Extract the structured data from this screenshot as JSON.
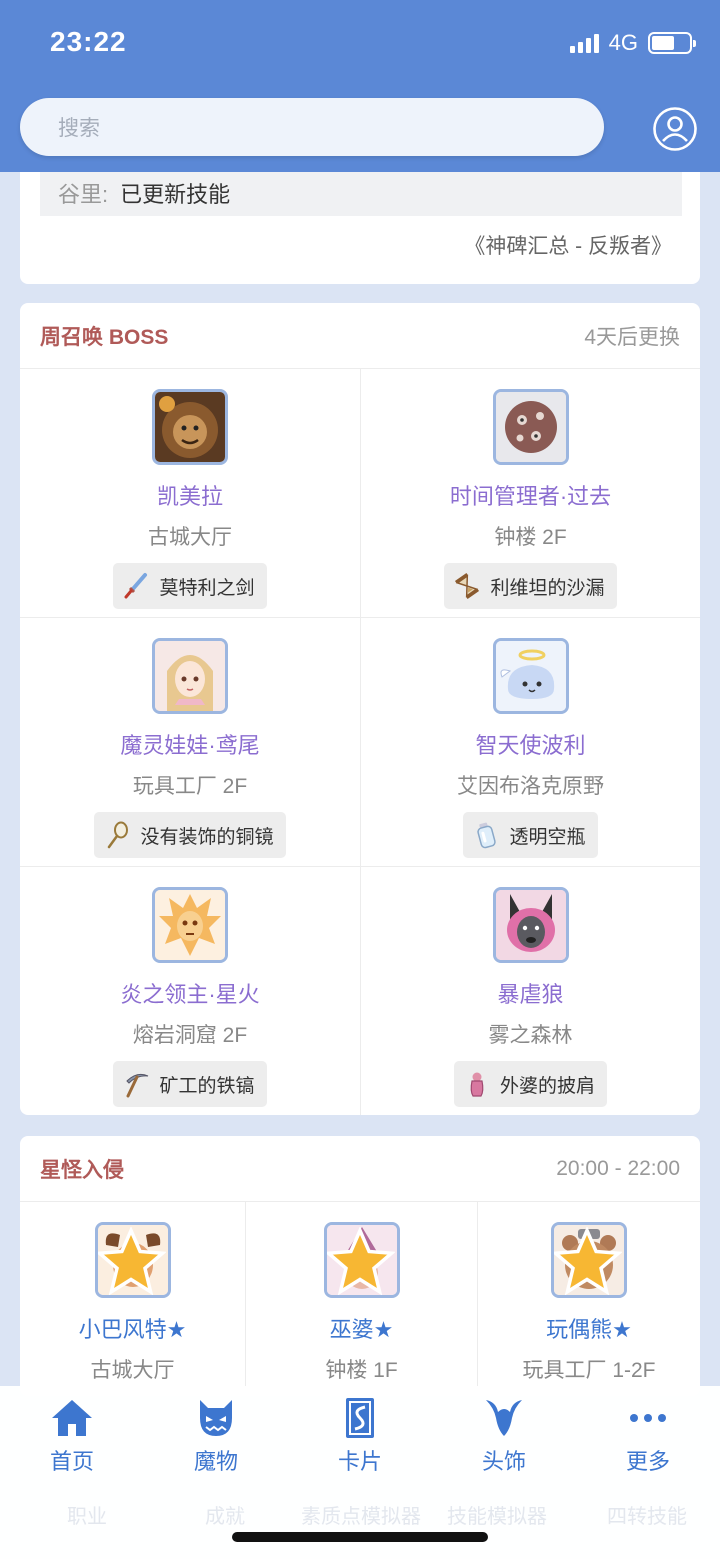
{
  "status": {
    "time": "23:22",
    "network": "4G"
  },
  "search": {
    "placeholder": "搜索"
  },
  "news": {
    "name": "谷里:",
    "text": "已更新技能",
    "source": "《神碑汇总 - 反叛者》"
  },
  "boss_section": {
    "title": "周召唤 BOSS",
    "side": "4天后更换",
    "items": [
      {
        "name": "凯美拉",
        "location": "古城大厅",
        "drop": "莫特利之剑",
        "icon": "lion-chimera-icon",
        "drop_icon": "sword-icon"
      },
      {
        "name": "时间管理者·过去",
        "location": "钟楼 2F",
        "drop": "利维坦的沙漏",
        "icon": "clock-boulder-icon",
        "drop_icon": "hourglass-icon"
      },
      {
        "name": "魔灵娃娃·鸢尾",
        "location": "玩具工厂 2F",
        "drop": "没有装饰的铜镜",
        "icon": "doll-icon",
        "drop_icon": "mirror-icon"
      },
      {
        "name": "智天使波利",
        "location": "艾因布洛克原野",
        "drop": "透明空瓶",
        "icon": "angel-poring-icon",
        "drop_icon": "bottle-icon"
      },
      {
        "name": "炎之领主·星火",
        "location": "熔岩洞窟 2F",
        "drop": "矿工的铁镐",
        "icon": "fire-lord-icon",
        "drop_icon": "pickaxe-icon"
      },
      {
        "name": "暴虐狼",
        "location": "雾之森林",
        "drop": "外婆的披肩",
        "icon": "wolf-grandma-icon",
        "drop_icon": "shawl-icon"
      }
    ]
  },
  "star_section": {
    "title": "星怪入侵",
    "side": "20:00 - 22:00",
    "items": [
      {
        "name": "小巴风特★",
        "location": "古城大厅",
        "icon": "baphomet-jr-icon"
      },
      {
        "name": "巫婆★",
        "location": "钟楼 1F",
        "icon": "witch-icon"
      },
      {
        "name": "玩偶熊★",
        "location": "玩具工厂 1-2F",
        "icon": "teddy-bear-icon"
      }
    ]
  },
  "tabs": [
    {
      "label": "首页",
      "icon": "home-icon"
    },
    {
      "label": "魔物",
      "icon": "monster-icon"
    },
    {
      "label": "卡片",
      "icon": "card-icon"
    },
    {
      "label": "头饰",
      "icon": "headwear-icon"
    },
    {
      "label": "更多",
      "icon": "more-icon"
    }
  ],
  "ghost_menu": [
    "职业",
    "成就",
    "素质点模拟器",
    "技能模拟器",
    "四转技能"
  ],
  "colors": {
    "header": "#5b88d6",
    "accent": "#3d76cf",
    "boss_name": "#8b6dd0",
    "section_title": "#b05a58"
  }
}
